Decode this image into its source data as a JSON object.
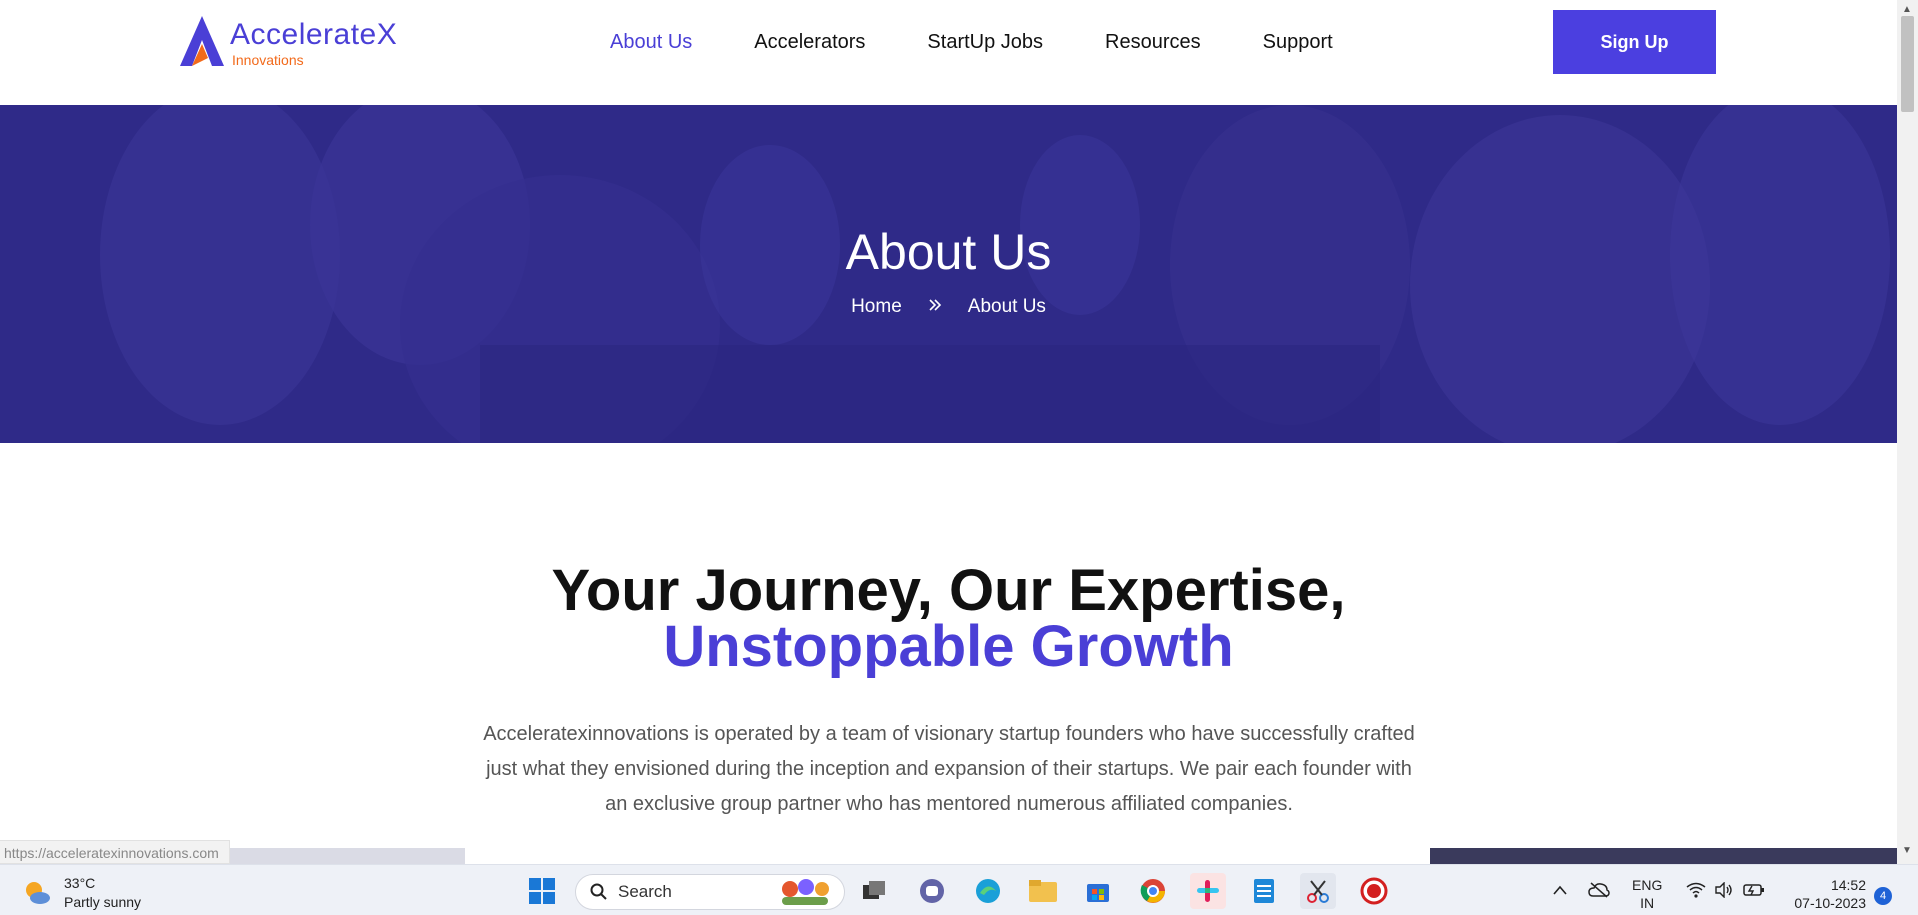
{
  "header": {
    "logo_name": "AccelerateX",
    "logo_sub": "Innovations",
    "nav": [
      "About Us",
      "Accelerators",
      "StartUp Jobs",
      "Resources",
      "Support"
    ],
    "active_nav": "About Us",
    "signup_label": "Sign Up"
  },
  "hero": {
    "title": "About Us",
    "breadcrumb": {
      "home": "Home",
      "current": "About Us"
    }
  },
  "main": {
    "headline_line1": "Your Journey, Our Expertise,",
    "headline_line2": "Unstoppable Growth",
    "intro": "Acceleratexinnovations is operated by a team of visionary startup founders who have successfully crafted just what they envisioned during the inception and expansion of their startups. We pair each founder with an exclusive group partner who has mentored numerous affiliated companies."
  },
  "browser": {
    "status_url": "https://acceleratexinnovations.com"
  },
  "taskbar": {
    "weather_temp": "33°C",
    "weather_desc": "Partly sunny",
    "search_label": "Search",
    "lang_line1": "ENG",
    "lang_line2": "IN",
    "time": "14:52",
    "date": "07-10-2023",
    "notification_count": "4"
  },
  "colors": {
    "brand": "#4a3fd6",
    "hero_bg": "#2f2a8a",
    "logo_orange": "#f26a1b"
  }
}
